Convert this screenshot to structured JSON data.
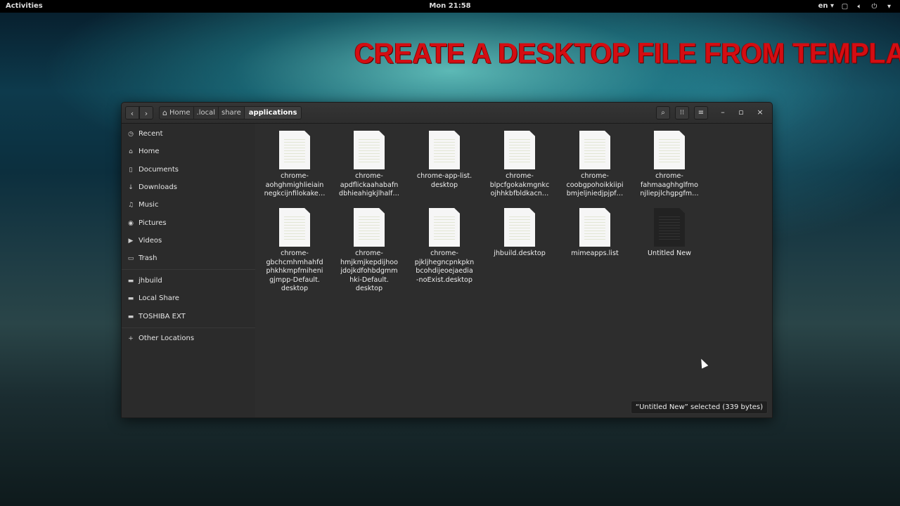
{
  "topbar": {
    "activities": "Activities",
    "clock": "Mon 21:58",
    "lang": "en",
    "icons": [
      "screen-icon",
      "volume-icon",
      "power-icon"
    ]
  },
  "banner": {
    "text": "CREATE A DESKTOP FILE FROM TEMPLATE",
    "color": "#d40d12"
  },
  "window": {
    "pathbar": [
      "Home",
      ".local",
      "share",
      "applications"
    ],
    "sidebar": [
      {
        "label": "Recent",
        "icon": "clock-icon"
      },
      {
        "label": "Home",
        "icon": "home-icon"
      },
      {
        "label": "Documents",
        "icon": "document-icon"
      },
      {
        "label": "Downloads",
        "icon": "download-icon"
      },
      {
        "label": "Music",
        "icon": "music-icon"
      },
      {
        "label": "Pictures",
        "icon": "camera-icon"
      },
      {
        "label": "Videos",
        "icon": "video-icon"
      },
      {
        "label": "Trash",
        "icon": "trash-icon"
      },
      {
        "label": "jhbuild",
        "icon": "folder-icon"
      },
      {
        "label": "Local Share",
        "icon": "folder-icon"
      },
      {
        "label": "TOSHIBA EXT",
        "icon": "drive-icon"
      },
      {
        "label": "Other Locations",
        "icon": "plus-icon"
      }
    ],
    "files": [
      {
        "lines": [
          "chrome-",
          "aohghmighlieiain",
          "negkcijnfilokake…"
        ]
      },
      {
        "lines": [
          "chrome-",
          "apdflickaahabafn",
          "dbhieahigkjlhalf…"
        ]
      },
      {
        "lines": [
          "chrome-app-list.",
          "desktop"
        ]
      },
      {
        "lines": [
          "chrome-",
          "blpcfgokakmgnkc",
          "ojhhkbfbldkacn…"
        ]
      },
      {
        "lines": [
          "chrome-",
          "coobgpohoikkiipi",
          "bmjeljniedjpjpf…"
        ]
      },
      {
        "lines": [
          "chrome-",
          "fahmaaghhglfmo",
          "njliepjlchgpgfm…"
        ]
      },
      {
        "lines": [
          "chrome-",
          "gbchcmhmhahfd",
          "phkhkmpfmiheni",
          "gjmpp-Default.",
          "desktop"
        ]
      },
      {
        "lines": [
          "chrome-",
          "hmjkmjkepdijhoo",
          "jdojkdfohbdgmm",
          "hki-Default.",
          "desktop"
        ]
      },
      {
        "lines": [
          "chrome-",
          "pjkljhegncpnkpkn",
          "bcohdijeoejaedia",
          "-noExist.desktop"
        ]
      },
      {
        "lines": [
          "jhbuild.desktop"
        ]
      },
      {
        "lines": [
          "mimeapps.list"
        ]
      },
      {
        "lines": [
          "Untitled New"
        ],
        "dark": true
      }
    ],
    "status": "“Untitled New” selected  (339 bytes)"
  }
}
